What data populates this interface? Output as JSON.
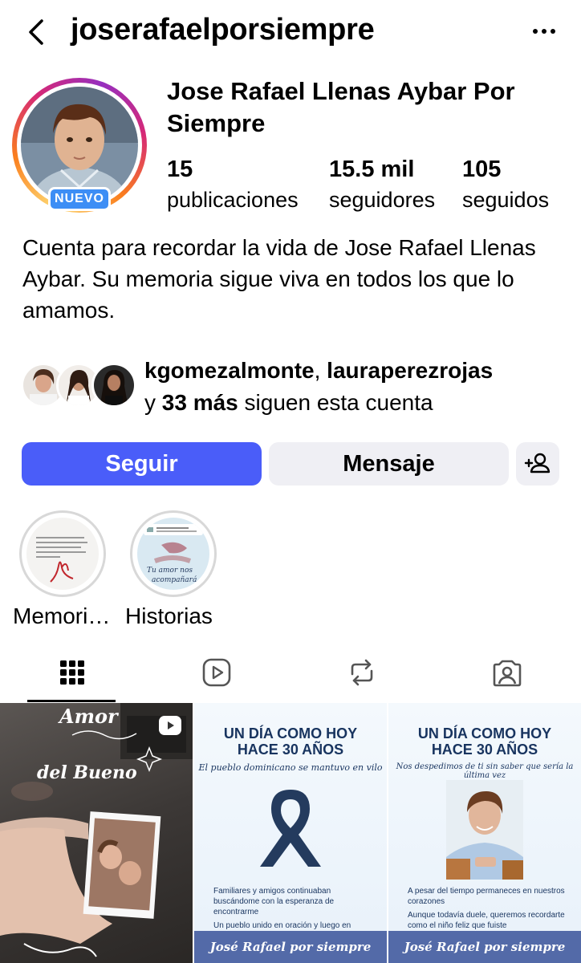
{
  "header": {
    "username": "joserafaelporsiempre",
    "back_icon": "chevron-left-icon",
    "more_icon": "more-horizontal-icon"
  },
  "profile": {
    "display_name": "Jose Rafael Llenas Aybar Por Siempre",
    "badge": "NUEVO",
    "stats": [
      {
        "value": "15",
        "label": "publicaciones"
      },
      {
        "value": "15.5 mil",
        "label": "seguidores"
      },
      {
        "value": "105",
        "label": "seguidos"
      }
    ],
    "bio": "Cuenta para recordar la vida de Jose Rafael Llenas Aybar. Su memoria sigue viva en todos los que lo amamos."
  },
  "followed_by": {
    "user1": "kgomezalmonte",
    "separator": ", ",
    "user2": "laura­perezrojas",
    "prefix": "y ",
    "more": "33 más",
    "suffix": " siguen esta cuenta"
  },
  "actions": {
    "follow": "Seguir",
    "message": "Mensaje",
    "add_user_icon": "add-person-icon"
  },
  "highlights": [
    {
      "label": "Memori…"
    },
    {
      "label": "Historias"
    }
  ],
  "tabs": [
    {
      "icon": "grid-icon",
      "active": true
    },
    {
      "icon": "reels-icon",
      "active": false
    },
    {
      "icon": "reposts-icon",
      "active": false
    },
    {
      "icon": "tagged-icon",
      "active": false
    }
  ],
  "posts": [
    {
      "script_top": "Amor",
      "script_bottom": "del Bueno",
      "type": "reel"
    },
    {
      "title_line1": "UN DÍA COMO HOY",
      "title_line2": "HACE 30 AÑOS",
      "subtitle": "El pueblo dominicano se mantuvo en vilo",
      "bullet1": "Familiares y amigos continuaban buscándome con la esperanza de encontrarme",
      "bullet2": "Un pueblo unido en oración y luego en tristeza cuando me encontraron sin vida",
      "banner": "José Rafael por siempre"
    },
    {
      "title_line1": "UN DÍA COMO HOY",
      "title_line2": "HACE 30 AÑOS",
      "subtitle": "Nos despedimos de ti sin saber que sería la última vez",
      "bullet1": "A pesar del tiempo permaneces en nuestros corazones",
      "bullet2": "Aunque todavía duele, queremos recordarte como el niño feliz que fuiste",
      "banner": "José Rafael por siempre"
    }
  ],
  "colors": {
    "follow_button": "#4a5df9",
    "secondary_button": "#efeff4",
    "nuevo_badge": "#3d8ef5",
    "post_navy": "#18345f",
    "post_banner": "#536aa8"
  }
}
